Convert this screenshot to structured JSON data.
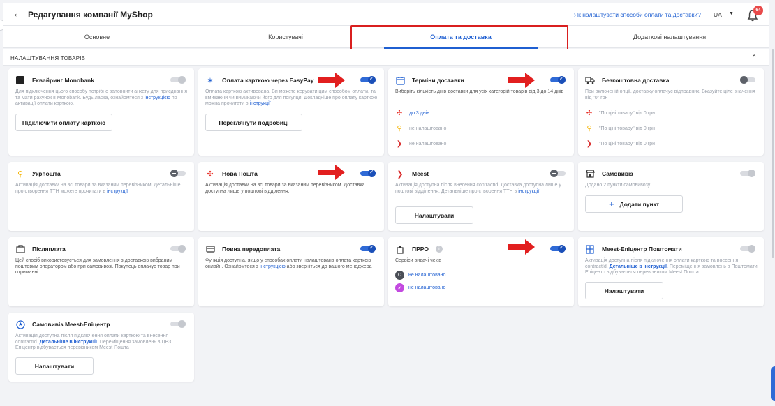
{
  "header": {
    "back_icon": "arrow-left-icon",
    "title": "Редагування компанії MyShop",
    "help_link": "Як налаштувати способи оплати та доставки?",
    "lang": "UA",
    "notifications_count": "64"
  },
  "tabs": [
    {
      "label": "Основне"
    },
    {
      "label": "Користувачі"
    },
    {
      "label": "Оплата та доставка",
      "active": true
    },
    {
      "label": "Додаткові налаштування"
    }
  ],
  "section": {
    "title": "НАЛАШТУВАННЯ ТОВАРІВ"
  },
  "cards": {
    "monobank": {
      "title": "Еквайринг Monobank",
      "desc_1": "Для підключення цього способу потрібно заповнити анкету для приєднання та мати рахунок в Monobank. Будь ласка, ознайомтеся з ",
      "desc_link": "інструкцією",
      "desc_2": " по активації оплати карткою.",
      "button": "Підключити оплату карткою",
      "toggle": "off"
    },
    "easypay": {
      "title": "Оплата карткою через EasyPay",
      "desc_1": "Оплата карткою активована. Ви можете керувати цим способом оплати, та вмикаючи чи вимикаючи його для покупця. Докладніше про оплату карткою можна прочитати в ",
      "desc_link": "інструкції",
      "button": "Переглянути подробиці",
      "toggle": "on"
    },
    "terms": {
      "title": "Терміни доставки",
      "desc": "Виберіть кількість днів доставки для усіх категорій товарів від 3 до 14 днів",
      "items": [
        {
          "text": "до 3 днів",
          "icon": "nova-poshta-icon"
        },
        {
          "text": "не налаштовано",
          "icon": "ukrposhta-icon"
        },
        {
          "text": "не налаштовано",
          "icon": "meest-icon"
        }
      ],
      "toggle": "on"
    },
    "free_delivery": {
      "title": "Безкоштовна доставка",
      "desc": "При включеній опції, доставку оплачує відправник. Вказуйте ціле значення від \"0\" грн",
      "items": [
        {
          "text": "\"По ціні товару\" від 0 грн",
          "icon": "nova-poshta-icon"
        },
        {
          "text": "\"По ціні товару\" від 0 грн",
          "icon": "ukrposhta-icon"
        },
        {
          "text": "\"По ціні товару\" від 0 грн",
          "icon": "meest-icon"
        }
      ],
      "toggle": "dark"
    },
    "ukrposhta": {
      "title": "Укрпошта",
      "desc_1": "Активація доставки на всі товари за вказаним перевізником. Детальніше про створення ТТН можете прочитати в ",
      "desc_link": "інструкції",
      "toggle": "dark"
    },
    "nova_poshta": {
      "title": "Нова Пошта",
      "desc": "Активація доставки на всі товари за вказаним перевізником. Доставка доступна лише у поштові відділення.",
      "toggle": "on"
    },
    "meest": {
      "title": "Meest",
      "desc_1": "Активація доступна після внесення contractId. Доставка доступна лише у поштові відділення. Детальніше про створення ТТН в ",
      "desc_link": "інструкції",
      "button": "Налаштувати",
      "toggle": "dark"
    },
    "pickup": {
      "title": "Самовивіз",
      "desc": "Додано 2 пункти самовивозу",
      "button": "Додати пункт",
      "toggle": "off"
    },
    "cod": {
      "title": "Післяплата",
      "desc": "Цей спосіб використовується для замовлення з доставкою вибраним поштовим оператором або при самовивозі. Покупець оплачує товар при отриманні",
      "toggle": "off"
    },
    "prepay": {
      "title": "Повна передоплата",
      "desc_1": "Функція доступна, якщо у способах оплати налаштована оплата карткою онлайн. Ознайомтеся з ",
      "desc_link": "інструкцією",
      "desc_2": " або зверніться до вашого менеджера",
      "toggle": "on"
    },
    "prro": {
      "title": "ПРРО",
      "desc": "Сервіси видачі чеків",
      "items": [
        {
          "text": "не налаштовано",
          "icon": "checkbox-service-icon"
        },
        {
          "text": "не налаштовано",
          "icon": "vchasno-service-icon"
        }
      ],
      "toggle": "on"
    },
    "meest_lockers": {
      "title": "Meest-Епіцентр Поштомати",
      "desc_1": "Активація доступна після підключення оплати карткою та внесення contractId. ",
      "desc_link": "Детальніше в інструкції",
      "desc_2": ". Переміщення замовлень в Поштомати Епіцентр відбувається перевізником Meest Пошта",
      "button": "Налаштувати",
      "toggle": "off"
    },
    "meest_pickup": {
      "title": "Самовивіз Meest-Епіцентр",
      "desc_1": "Активація доступна після підключення оплати карткою та внесення contractId. ",
      "desc_link": "Детальніше в інструкції",
      "desc_2": ". Переміщення замовлень в ЦВЗ Епіцентр відбувається перевізником Meest Пошта",
      "button": "Налаштувати",
      "toggle": "off"
    }
  },
  "colors": {
    "accent": "#1f5fd1",
    "annotation_red": "#d91f1f",
    "badge": "#e84a4a"
  }
}
